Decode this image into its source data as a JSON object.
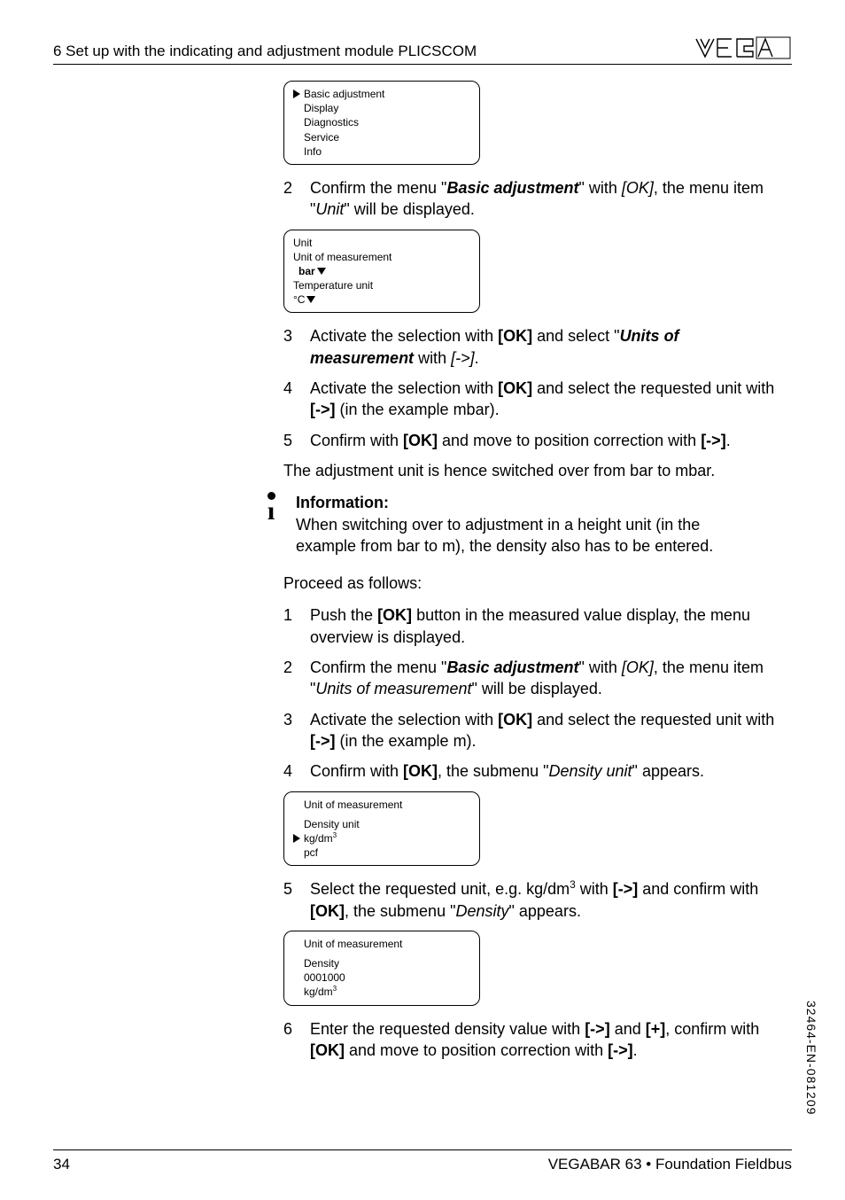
{
  "header": {
    "section": "6   Set up with the indicating and adjustment module PLICSCOM"
  },
  "lcd1": {
    "items": [
      "Basic adjustment",
      "Display",
      "Diagnostics",
      "Service",
      "Info"
    ]
  },
  "step2a": {
    "num": "2",
    "pre": "Confirm the menu \"",
    "bi1": "Basic adjustment",
    "mid1": "\" with ",
    "i2": "[OK]",
    "mid2": ", the menu item \"",
    "i3": "Unit",
    "post": "\" will be displayed."
  },
  "lcd2": {
    "l1": "Unit",
    "l2": "Unit of measurement",
    "l3b": "bar",
    "l4": "Temperature unit",
    "l5": "°C"
  },
  "step3": {
    "num": "3",
    "pre": "Activate the selection with ",
    "b1": "[OK]",
    "mid1": " and select \"",
    "bi2": "Units of measurement",
    "mid2": " with ",
    "i3": "[->]",
    "post": "."
  },
  "step4": {
    "num": "4",
    "pre": "Activate the selection with ",
    "b1": "[OK]",
    "mid1": " and select the requested unit with ",
    "b2": "[->]",
    "post": " (in the example mbar)."
  },
  "step5a": {
    "num": "5",
    "pre": "Confirm with ",
    "b1": "[OK]",
    "mid1": " and move to position correction with ",
    "b2": "[->]",
    "post": "."
  },
  "para1": "The adjustment unit is hence switched over from bar to mbar.",
  "info": {
    "title": "Information:",
    "body": "When switching over to adjustment in a height unit (in the example from bar to m), the density also has to be entered."
  },
  "para2": "Proceed as follows:",
  "step1b": {
    "num": "1",
    "pre": "Push the ",
    "b1": "[OK]",
    "post": " button in the measured value display, the menu overview is displayed."
  },
  "step2b": {
    "num": "2",
    "pre": "Confirm the menu \"",
    "bi1": "Basic adjustment",
    "mid1": "\" with ",
    "i2": "[OK]",
    "mid2": ", the menu item \"",
    "i3": "Units of measurement",
    "post": "\" will be displayed."
  },
  "step3b": {
    "num": "3",
    "pre": "Activate the selection with ",
    "b1": "[OK]",
    "mid1": " and select the requested unit with ",
    "b2": "[->]",
    "post": " (in the example m)."
  },
  "step4b": {
    "num": "4",
    "pre": "Confirm with ",
    "b1": "[OK]",
    "mid1": ", the submenu \"",
    "i2": "Density unit",
    "post": "\" appears."
  },
  "lcd3": {
    "l1": "Unit of measurement",
    "l3": "Density unit",
    "l4": "kg/dm",
    "l5": "pcf"
  },
  "step5b": {
    "num": "5",
    "pre": "Select the requested unit, e.g. kg/dm",
    "mid1": " with ",
    "b1": "[->]",
    "mid2": " and confirm with ",
    "b2": "[OK]",
    "mid3": ", the submenu \"",
    "i3": "Density",
    "post": "\" appears."
  },
  "lcd4": {
    "l1": "Unit of measurement",
    "l3": "Density",
    "l4": "0001000",
    "l5": "kg/dm"
  },
  "step6": {
    "num": "6",
    "pre": "Enter the requested density value with ",
    "b1": "[->]",
    "mid1": " and ",
    "b2": "[+]",
    "mid2": ", confirm with ",
    "b3": "[OK]",
    "mid3": " and move to position correction with ",
    "b4": "[->]",
    "post": "."
  },
  "side": "32464-EN-081209",
  "footer": {
    "page": "34",
    "product": "VEGABAR 63 • Foundation Fieldbus"
  }
}
